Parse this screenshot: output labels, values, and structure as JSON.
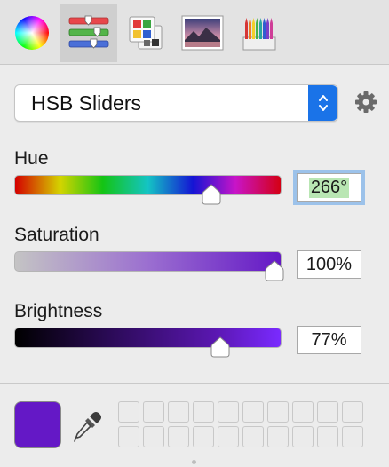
{
  "toolbar": {
    "tabs": [
      {
        "name": "color-wheel",
        "icon": "color-wheel-icon",
        "selected": false
      },
      {
        "name": "color-sliders",
        "icon": "sliders-icon",
        "selected": true
      },
      {
        "name": "color-palettes",
        "icon": "palettes-icon",
        "selected": false
      },
      {
        "name": "image-palettes",
        "icon": "image-icon",
        "selected": false
      },
      {
        "name": "pencils",
        "icon": "pencils-icon",
        "selected": false
      }
    ]
  },
  "mode_popup": {
    "selected": "HSB Sliders",
    "icon": "popup-stepper-icon"
  },
  "settings": {
    "icon": "gear-icon"
  },
  "sliders": {
    "hue": {
      "label": "Hue",
      "value_text": "266°",
      "value": 266,
      "max": 360,
      "focused": true
    },
    "saturation": {
      "label": "Saturation",
      "value_text": "100%",
      "value": 100,
      "max": 100
    },
    "brightness": {
      "label": "Brightness",
      "value_text": "77%",
      "value": 77,
      "max": 100
    }
  },
  "current_color": "#6418c6",
  "accent": "#1a73e8",
  "eyedropper": {
    "icon": "eyedropper-icon"
  },
  "swatch_wells": {
    "rows": 2,
    "columns": 10,
    "filled": 0
  }
}
